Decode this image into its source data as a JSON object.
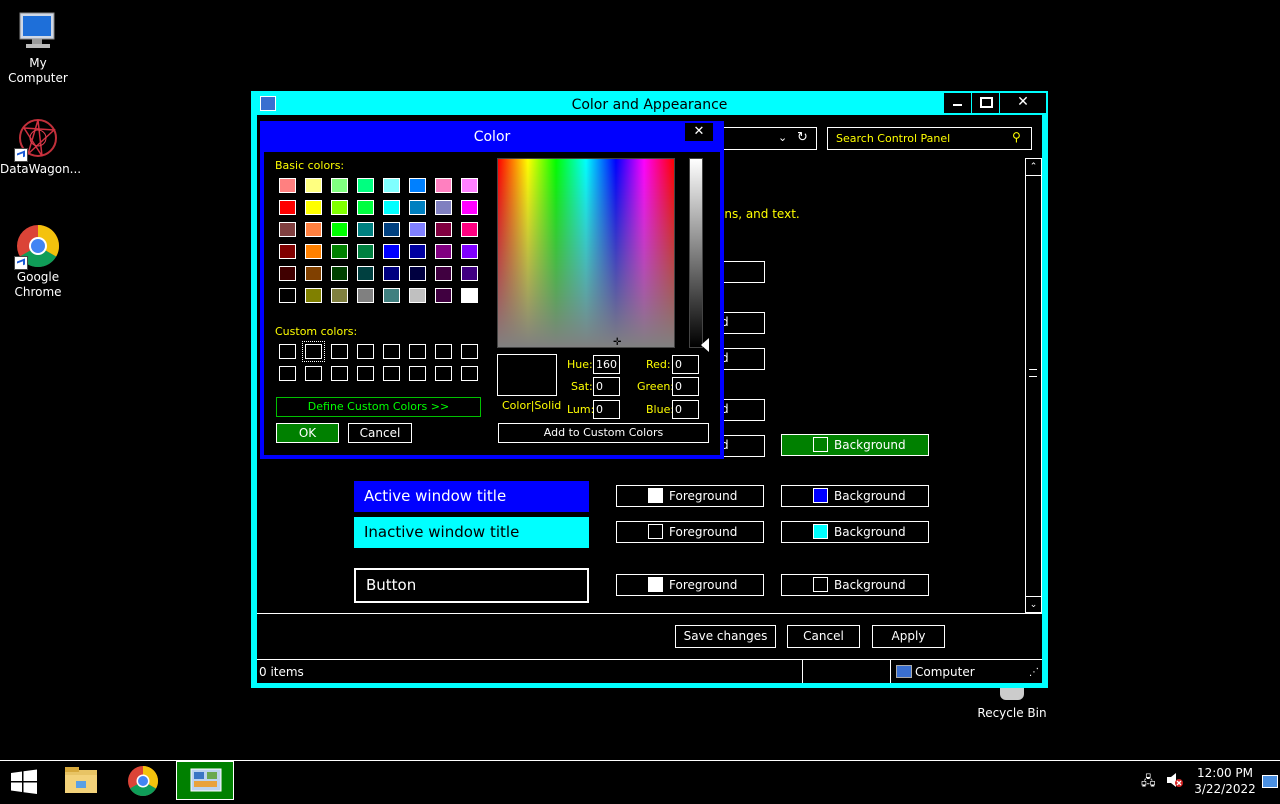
{
  "desktop": {
    "icons": [
      {
        "label": "My Computer",
        "icon": "computer-icon"
      },
      {
        "label": "DataWagon...",
        "icon": "datawagon-icon"
      },
      {
        "label": "Google Chrome",
        "icon": "chrome-icon"
      },
      {
        "label": "Recycle Bin",
        "icon": "recycle-bin-icon"
      }
    ]
  },
  "main_window": {
    "title": "Color and Appearance",
    "search_placeholder": "Search Control Panel",
    "desc_text": "ons, and text.",
    "rows": [
      {
        "sample": "Active window title",
        "fg_label": "Foreground",
        "bg_label": "Background",
        "fg_color": "#ffffff",
        "bg_color": "#0000ff"
      },
      {
        "sample": "Inactive window title",
        "fg_label": "Foreground",
        "bg_label": "Background",
        "fg_color": "#000000",
        "bg_color": "#00ffff"
      },
      {
        "sample": "Button",
        "fg_label": "Foreground",
        "bg_label": "Background",
        "fg_color": "#ffffff",
        "bg_color": "#000000"
      }
    ],
    "partial_labels": [
      "d",
      "d",
      "d",
      "d"
    ],
    "selected_bg_label": "Background",
    "buttons": {
      "save": "Save changes",
      "cancel": "Cancel",
      "apply": "Apply"
    },
    "status": {
      "items": "0 items",
      "location": "Computer"
    }
  },
  "color_dialog": {
    "title": "Color",
    "basic_colors_label": "Basic colors:",
    "custom_colors_label": "Custom colors:",
    "basic_colors": [
      "#ff8080",
      "#ffff80",
      "#80ff80",
      "#00ff80",
      "#80ffff",
      "#0080ff",
      "#ff80c0",
      "#ff80ff",
      "#ff0000",
      "#ffff00",
      "#80ff00",
      "#00ff40",
      "#00ffff",
      "#0080c0",
      "#8080c0",
      "#ff00ff",
      "#804040",
      "#ff8040",
      "#00ff00",
      "#008080",
      "#004080",
      "#8080ff",
      "#800040",
      "#ff0080",
      "#800000",
      "#ff8000",
      "#008000",
      "#008040",
      "#0000ff",
      "#0000a0",
      "#800080",
      "#8000ff",
      "#400000",
      "#804000",
      "#004000",
      "#004040",
      "#000080",
      "#000040",
      "#400040",
      "#400080",
      "#000000",
      "#808000",
      "#808040",
      "#808080",
      "#408080",
      "#c0c0c0",
      "#400040",
      "#ffffff"
    ],
    "define_custom": "Define Custom Colors >>",
    "ok": "OK",
    "cancel": "Cancel",
    "color_solid": "Color|Solid",
    "fields": {
      "hue_label": "Hue:",
      "hue": "160",
      "sat_label": "Sat:",
      "sat": "0",
      "lum_label": "Lum:",
      "lum": "0",
      "red_label": "Red:",
      "red": "0",
      "green_label": "Green:",
      "green": "0",
      "blue_label": "Blue:",
      "blue": "0"
    },
    "add_custom": "Add to Custom Colors"
  },
  "taskbar": {
    "time": "12:00 PM",
    "date": "3/22/2022"
  }
}
